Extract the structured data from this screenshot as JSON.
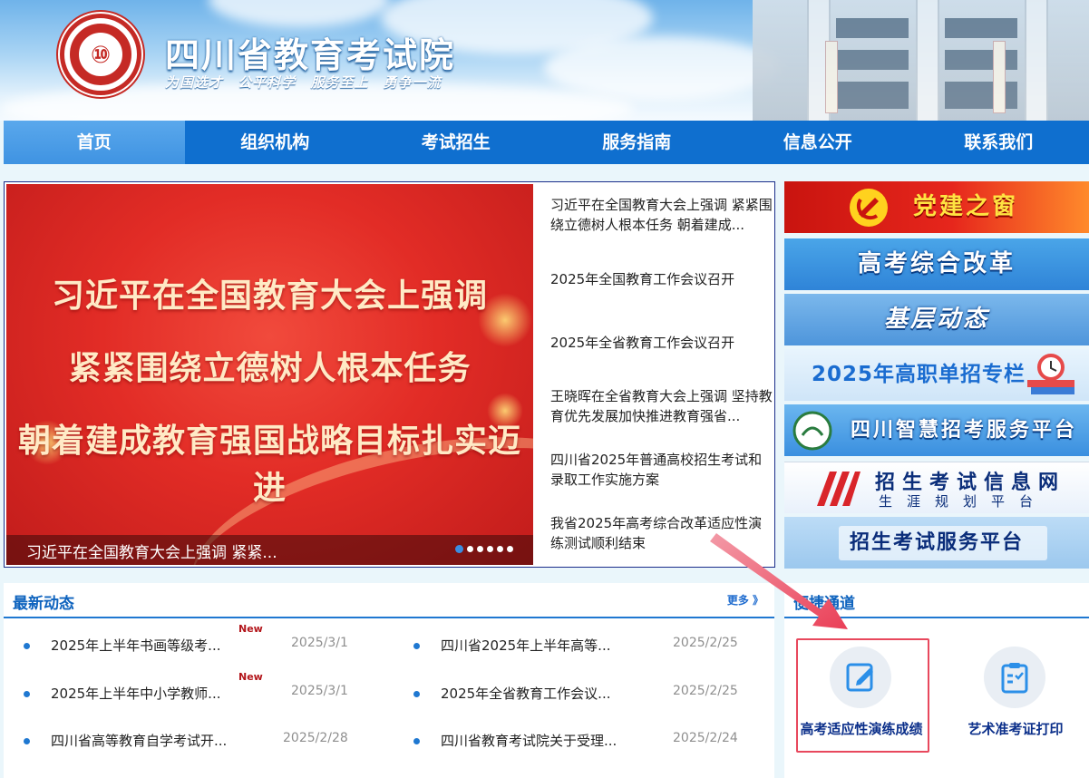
{
  "header": {
    "title": "四川省教育考试院",
    "slogan": "为国选才  公平科学  服务至上  勇争一流"
  },
  "nav": {
    "items": [
      {
        "label": "首页"
      },
      {
        "label": "组织机构"
      },
      {
        "label": "考试招生"
      },
      {
        "label": "服务指南"
      },
      {
        "label": "信息公开"
      },
      {
        "label": "联系我们"
      }
    ]
  },
  "banner": {
    "lines": [
      "习近平在全国教育大会上强调",
      "紧紧围绕立德树人根本任务",
      "朝着建成教育强国战略目标扎实迈进"
    ],
    "caption": "习近平在全国教育大会上强调 紧紧..."
  },
  "headlines": [
    "习近平在全国教育大会上强调 紧紧围绕立德树人根本任务 朝着建成...",
    "2025年全国教育工作会议召开",
    "2025年全省教育工作会议召开",
    "王晓晖在全省教育大会上强调 坚持教育优先发展加快推进教育强省...",
    "四川省2025年普通高校招生考试和录取工作实施方案",
    "我省2025年高考综合改革适应性演练测试顺利结束"
  ],
  "side_banners": {
    "party": "党建之窗",
    "gaokao": "高考综合改革",
    "jiceng": "基层动态",
    "danzhao": "2025年高职单招专栏",
    "zhihui": "四川智慧招考服务平台",
    "xinxi_title": "招生考试信息网",
    "xinxi_sub": "生涯规划平台",
    "fuwu": "招生考试服务平台"
  },
  "latest": {
    "title": "最新动态",
    "more": "更多 》",
    "new_badge": "New",
    "items": [
      {
        "title": "2025年上半年书画等级考...",
        "date": "2025/3/1"
      },
      {
        "title": "四川省2025年上半年高等...",
        "date": "2025/2/25"
      },
      {
        "title": "2025年上半年中小学教师...",
        "date": "2025/3/1"
      },
      {
        "title": "2025年全省教育工作会议...",
        "date": "2025/2/25"
      },
      {
        "title": "四川省高等教育自学考试开...",
        "date": "2025/2/28"
      },
      {
        "title": "四川省教育考试院关于受理...",
        "date": "2025/2/24"
      }
    ]
  },
  "quick": {
    "title": "便捷通道",
    "items": [
      {
        "label": "高考适应性演练成绩"
      },
      {
        "label": "艺术准考证打印"
      }
    ]
  },
  "colors": {
    "nav": "#0f6fcf",
    "accent_red": "#e22c26",
    "highlight": "#e8485d"
  }
}
